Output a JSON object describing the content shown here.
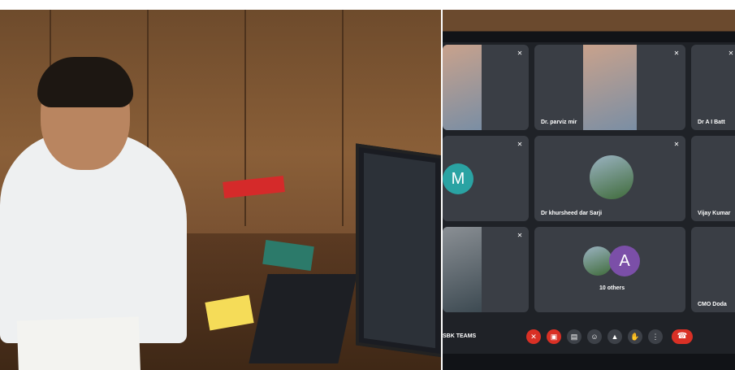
{
  "meeting": {
    "brand_label": "SBK TEAMS",
    "participants": [
      {
        "name": ""
      },
      {
        "name": "Dr. parviz mir"
      },
      {
        "name": "Dr A I Batt"
      },
      {
        "name": "",
        "initial": "M"
      },
      {
        "name": "Dr khursheed dar Sarji"
      },
      {
        "name": "Vijay Kumar"
      },
      {
        "name": ""
      },
      {
        "name": "10 others",
        "initial": "A"
      },
      {
        "name": "CMO Doda"
      }
    ],
    "colors": {
      "tile_bg": "#3a3e45",
      "avatar_m": "#2aa3a3",
      "avatar_a": "#7b4fa8",
      "hangup": "#d93025"
    },
    "icons": [
      "mic-off-icon",
      "camera-off-icon",
      "captions-icon",
      "emoji-icon",
      "present-icon",
      "raise-hand-icon",
      "more-icon",
      "hangup-icon"
    ]
  }
}
